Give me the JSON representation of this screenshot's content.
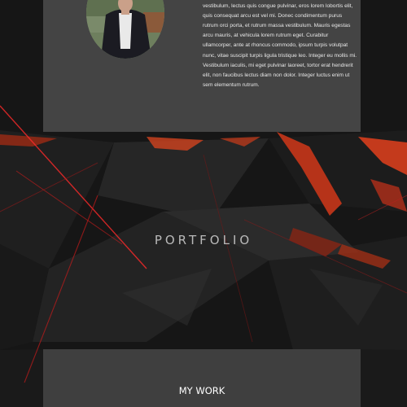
{
  "about": {
    "bio": "vestibulum, lectus quis congue pulvinar, eros lorem lobortis elit, quis consequat arcu est vel mi. Donec condimentum purus rutrum orci porta, et rutrum massa vestibulum. Mauris egestas arcu mauris, at vehicula lorem rutrum eget. Curabitur ullamcorper, ante at rhoncus commodo, ipsum turpis volutpat nunc, vitae suscipit turpis ligula tristique leo. Integer eu mollis mi. Vestibulum iaculis, mi eget pulvinar laoreet, tortor erat hendrerit elit, non faucibus lectus diam non dolor. Integer luctus enim ut sem elementum rutrum."
  },
  "portfolio": {
    "title": "PORTFOLIO"
  },
  "work": {
    "title": "MY WORK"
  },
  "colors": {
    "background": "#141414",
    "card": "#444444",
    "accent": "#e2401c"
  }
}
